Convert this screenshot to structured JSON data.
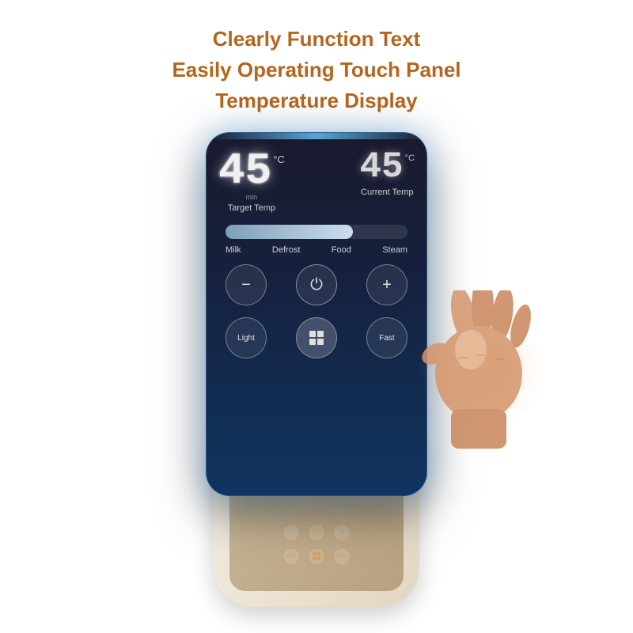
{
  "header": {
    "line1": "Clearly Function Text",
    "line2": "Easily Operating Touch Panel",
    "line3": "Temperature Display"
  },
  "panel": {
    "target_temp": "45",
    "current_temp": "45",
    "celsius_unit": "°C",
    "min_label": "min",
    "target_label": "Target Temp",
    "current_label": "Current Temp",
    "progress_percent": 70,
    "modes": [
      "Milk",
      "Defrost",
      "Food",
      "Steam"
    ],
    "buttons": {
      "minus": "−",
      "power": "⏻",
      "plus": "+",
      "light": "Light",
      "grid": "grid",
      "fast": "Fast"
    }
  },
  "colors": {
    "header_text": "#b5651d",
    "panel_bg_start": "#1a1a2e",
    "panel_bg_end": "#0f3460",
    "digit_color": "#f0f0f0",
    "glow_color": "rgba(100,200,255,0.4)"
  }
}
